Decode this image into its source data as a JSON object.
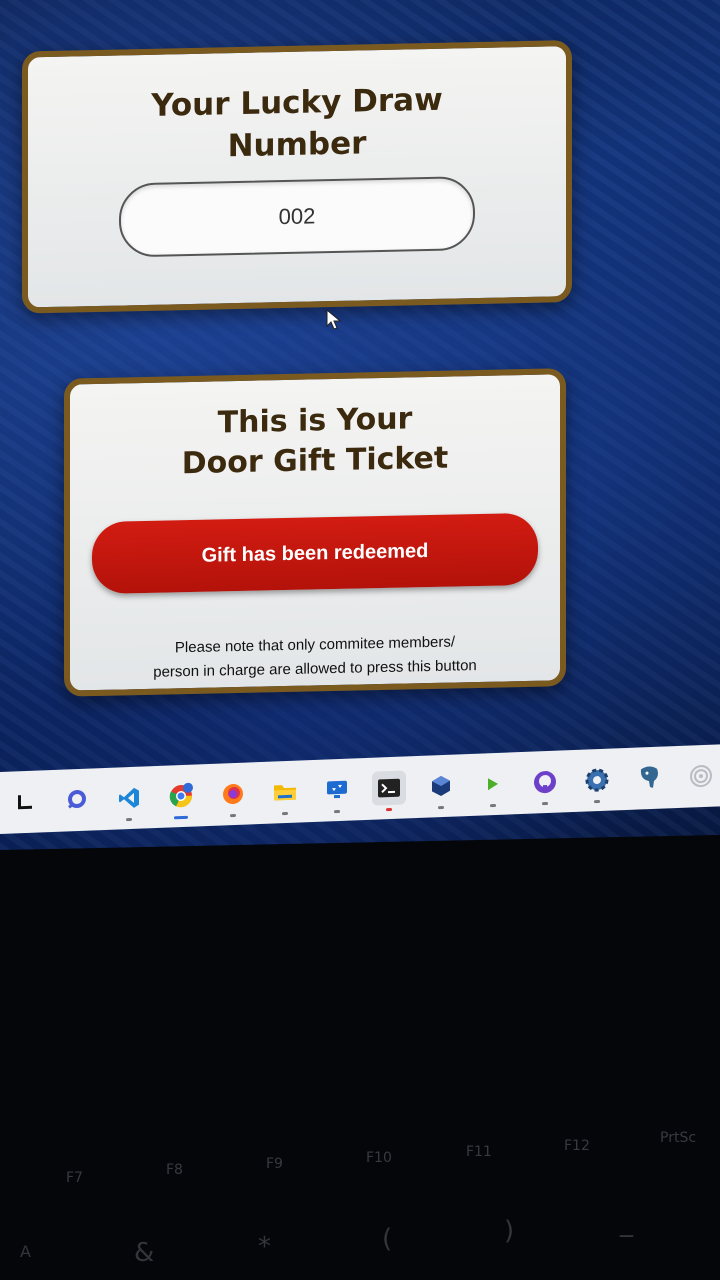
{
  "lucky_draw": {
    "title_line1": "Your Lucky Draw",
    "title_line2": "Number",
    "number": "002"
  },
  "door_gift": {
    "title_line1": "This is Your",
    "title_line2": "Door Gift Ticket",
    "button_label": "Gift has been redeemed",
    "note_line1": "Please note that only commitee members/",
    "note_line2": "person in charge are allowed to press this button"
  },
  "taskbar": {
    "icons": [
      "start-icon",
      "chat-icon",
      "vscode-icon",
      "chrome-icon",
      "firefox-icon",
      "file-explorer-icon",
      "remote-desktop-icon",
      "terminal-icon",
      "virtualbox-icon",
      "play-icon",
      "github-desktop-icon",
      "settings-icon",
      "postgres-icon",
      "network-icon"
    ]
  },
  "keyboard": {
    "fkeys": [
      "F7",
      "F8",
      "F9",
      "F10",
      "F11",
      "F12",
      "PrtSc"
    ],
    "symbols": [
      "A",
      "&",
      "*",
      "(",
      ")",
      "_"
    ]
  },
  "colors": {
    "card_border": "#7a5a1f",
    "button_red": "#c8170e",
    "title_brown": "#3b2a0e"
  }
}
